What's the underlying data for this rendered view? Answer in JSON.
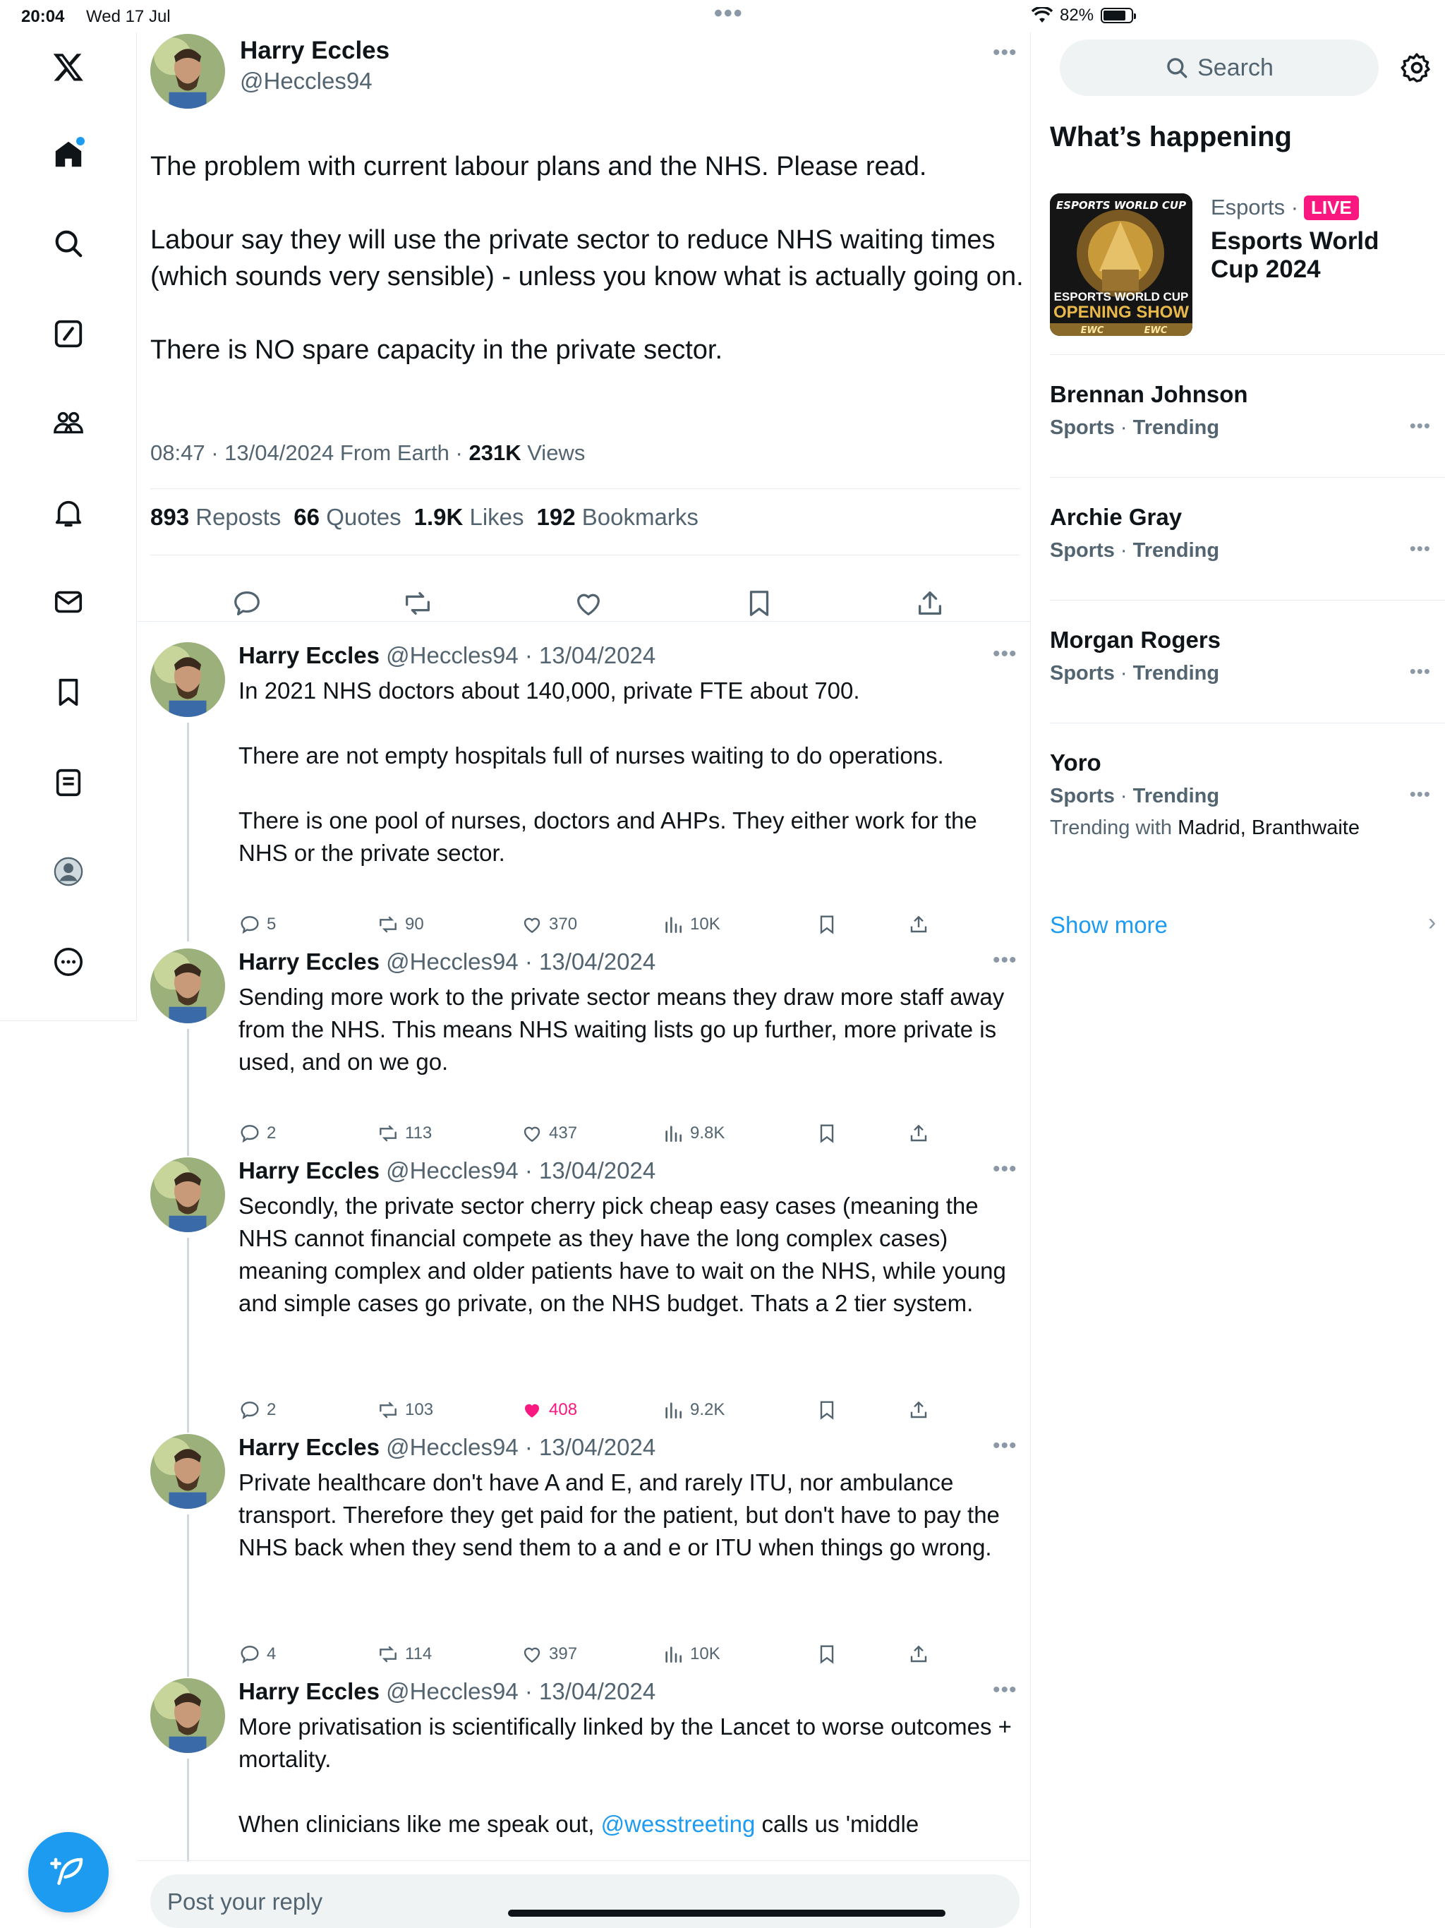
{
  "status": {
    "time": "20:04",
    "date": "Wed 17 Jul",
    "battery": "82%",
    "battery_level": 0.82
  },
  "nav": {
    "items": [
      "x-logo",
      "home-icon",
      "search-icon",
      "grok-icon",
      "communities-icon",
      "notifications-icon",
      "messages-icon",
      "bookmarks-icon",
      "lists-icon",
      "profile-icon",
      "more-icon"
    ]
  },
  "tweet": {
    "author_name": "Harry Eccles",
    "author_handle": "@Heccles94",
    "paragraphs": [
      "The problem with current labour plans and the NHS. Please read.",
      "Labour say they will use the private sector to reduce NHS waiting times (which sounds very sensible) - unless you know what is actually going on.",
      "There is NO spare capacity in the private sector."
    ],
    "timestamp": "08:47 · 13/04/2024 From Earth · ",
    "views_count": "231K",
    "views_label": " Views",
    "reposts_count": "893",
    "reposts_label": "Reposts",
    "quotes_count": "66",
    "quotes_label": "Quotes",
    "likes_count": "1.9K",
    "likes_label": "Likes",
    "bookmarks_count": "192",
    "bookmarks_label": "Bookmarks"
  },
  "replies": [
    {
      "name": "Harry Eccles",
      "meta": " @Heccles94 · 13/04/2024",
      "paragraphs": [
        "In 2021 NHS doctors about 140,000, private FTE about 700.",
        "There are not empty hospitals full of nurses waiting to do operations.",
        "There is one pool of nurses, doctors and AHPs. They either work for the NHS or the private sector."
      ],
      "replies": "5",
      "reposts": "90",
      "likes": "370",
      "views": "10K",
      "liked": false
    },
    {
      "name": "Harry Eccles",
      "meta": " @Heccles94 · 13/04/2024",
      "paragraphs": [
        "Sending more work to the private sector means they draw more staff away from the NHS. This means NHS waiting lists go up further, more private is used, and on we go."
      ],
      "replies": "2",
      "reposts": "113",
      "likes": "437",
      "views": "9.8K",
      "liked": false
    },
    {
      "name": "Harry Eccles",
      "meta": " @Heccles94 · 13/04/2024",
      "paragraphs": [
        "Secondly, the private sector cherry pick cheap easy cases (meaning the NHS cannot financial compete as they have the long complex cases) meaning  complex and older patients have to wait on the NHS, while young and simple cases go private, on the NHS budget. Thats a 2 tier system."
      ],
      "replies": "2",
      "reposts": "103",
      "likes": "408",
      "views": "9.2K",
      "liked": true
    },
    {
      "name": "Harry Eccles",
      "meta": " @Heccles94 · 13/04/2024",
      "paragraphs": [
        "Private healthcare don't have A and E, and rarely ITU, nor ambulance transport. Therefore they get paid for the patient, but don't have to pay the NHS back when they send them to a and e or ITU when things go wrong."
      ],
      "replies": "4",
      "reposts": "114",
      "likes": "397",
      "views": "10K",
      "liked": false
    },
    {
      "name": "Harry Eccles",
      "meta": " @Heccles94 · 13/04/2024",
      "paragraphs": [
        "More privatisation is scientifically linked by the Lancet to worse outcomes + mortality."
      ],
      "partial_prefix": "When clinicians like me speak out, ",
      "mention": "@wesstreeting",
      "partial_suffix": " calls us 'middle"
    }
  ],
  "composer": {
    "placeholder": "Post your reply"
  },
  "sidebar": {
    "search_label": "Search",
    "section_title": "What’s happening",
    "featured": {
      "category": "Esports ·",
      "live_badge": "LIVE",
      "title": "Esports World Cup 2024",
      "thumb_top": "ESPORTS WORLD CUP",
      "thumb_line1": "ESPORTS WORLD CUP",
      "thumb_line2": "OPENING SHOW",
      "thumb_footer": "EWC"
    },
    "trends": [
      {
        "name": "Brennan Johnson",
        "category": "Sports",
        "status": "Trending"
      },
      {
        "name": "Archie Gray",
        "category": "Sports",
        "status": "Trending"
      },
      {
        "name": "Morgan Rogers",
        "category": "Sports",
        "status": "Trending"
      },
      {
        "name": "Yoro",
        "category": "Sports",
        "status": "Trending",
        "with_label": "Trending with",
        "with_names": "Madrid, Branthwaite"
      }
    ],
    "show_more": "Show more"
  },
  "colors": {
    "accent": "#1d9bf0",
    "like": "#f91880",
    "text": "#0f1419",
    "muted": "#536471"
  }
}
